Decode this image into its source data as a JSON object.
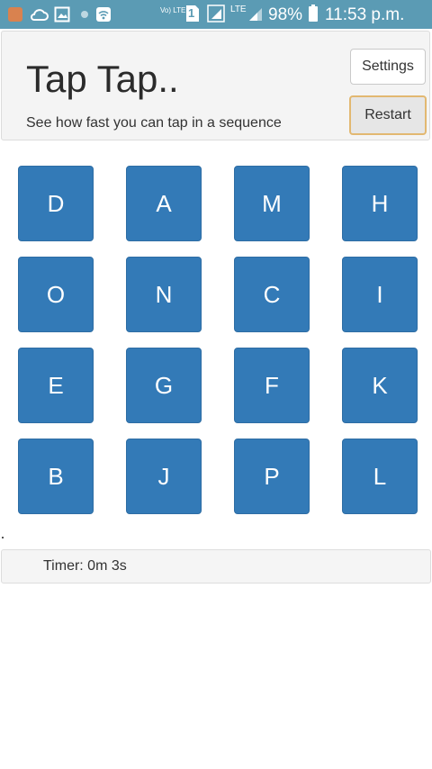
{
  "statusbar": {
    "network_label": "Vo) LTE",
    "sim_number": "1",
    "lte_label": "LTE",
    "battery_percent": "98%",
    "time": "11:53 p.m.",
    "icons": [
      "app-icon",
      "cloud-wifi-icon",
      "gallery-icon",
      "dot-icon",
      "wifi-icon",
      "volte-icon",
      "sim-icon",
      "signal-icon",
      "lte-icon",
      "signal-strength-icon",
      "battery-icon"
    ]
  },
  "header": {
    "title": "Tap Tap..",
    "subtitle": "See how fast you can tap in a sequence",
    "settings_label": "Settings",
    "restart_label": "Restart"
  },
  "grid": {
    "tiles": [
      "D",
      "A",
      "M",
      "H",
      "O",
      "N",
      "C",
      "I",
      "E",
      "G",
      "F",
      "K",
      "B",
      "J",
      "P",
      "L"
    ]
  },
  "timer": {
    "text": "Timer: 0m 3s"
  },
  "colors": {
    "statusbar": "#5b9bb4",
    "tile": "#337ab7",
    "restart_border": "#e2b871"
  }
}
